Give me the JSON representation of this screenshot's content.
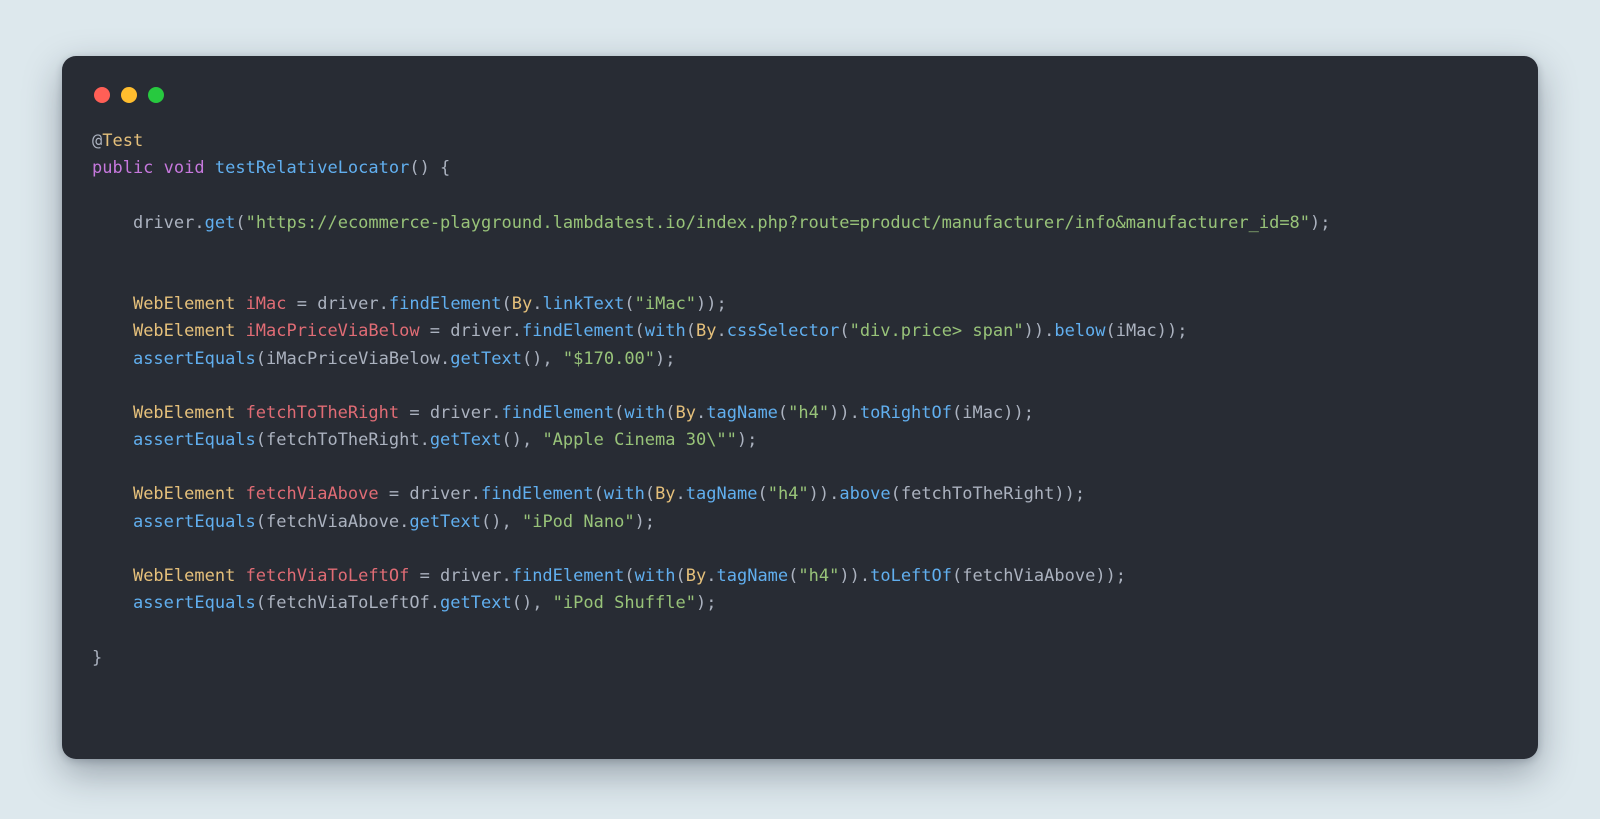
{
  "traffic_lights": {
    "red": "#ff5f56",
    "yellow": "#ffbd2e",
    "green": "#27c93f"
  },
  "code": {
    "annotation": {
      "at": "@",
      "name": "Test"
    },
    "decl": {
      "public": "public",
      "void": "void",
      "fn": "testRelativeLocator",
      "open": "() {"
    },
    "driver_get": {
      "obj": "driver",
      "dot": ".",
      "get": "get",
      "lp": "(",
      "url": "\"https://ecommerce-playground.lambdatest.io/index.php?route=product/manufacturer/info&manufacturer_id=8\"",
      "rp": ");"
    },
    "l1": {
      "type": "WebElement",
      "var": "iMac",
      "eq": " = ",
      "obj": "driver",
      "dot": ".",
      "find": "findElement",
      "lp": "(",
      "by": "By",
      "dot2": ".",
      "linkText": "linkText",
      "lp2": "(",
      "arg": "\"iMac\"",
      "rp2": ")",
      "rp": ");"
    },
    "l2": {
      "type": "WebElement",
      "var": "iMacPriceViaBelow",
      "eq": " = ",
      "obj": "driver",
      "dot": ".",
      "find": "findElement",
      "lp": "(",
      "with": "with",
      "lp2": "(",
      "by": "By",
      "dot2": ".",
      "css": "cssSelector",
      "lp3": "(",
      "sel": "\"div.price> span\"",
      "rp3": ")",
      "rp2": ")",
      "dot3": ".",
      "below": "below",
      "lp4": "(",
      "arg": "iMac",
      "rp4": ")",
      "rp": ");"
    },
    "l3": {
      "assert": "assertEquals",
      "lp": "(",
      "obj": "iMacPriceViaBelow",
      "dot": ".",
      "get": "getText",
      "lp2": "()",
      "comma": ", ",
      "val": "\"$170.00\"",
      "rp": ");"
    },
    "l4": {
      "type": "WebElement",
      "var": "fetchToTheRight",
      "eq": " = ",
      "obj": "driver",
      "dot": ".",
      "find": "findElement",
      "lp": "(",
      "with": "with",
      "lp2": "(",
      "by": "By",
      "dot2": ".",
      "tag": "tagName",
      "lp3": "(",
      "arg": "\"h4\"",
      "rp3": ")",
      "rp2": ")",
      "dot3": ".",
      "toRight": "toRightOf",
      "lp4": "(",
      "argv": "iMac",
      "rp4": ")",
      "rp": ");"
    },
    "l5": {
      "assert": "assertEquals",
      "lp": "(",
      "obj": "fetchToTheRight",
      "dot": ".",
      "get": "getText",
      "lp2": "()",
      "comma": ", ",
      "val": "\"Apple Cinema 30\\\"\"",
      "rp": ");"
    },
    "l6": {
      "type": "WebElement",
      "var": "fetchViaAbove",
      "eq": " = ",
      "obj": "driver",
      "dot": ".",
      "find": "findElement",
      "lp": "(",
      "with": "with",
      "lp2": "(",
      "by": "By",
      "dot2": ".",
      "tag": "tagName",
      "lp3": "(",
      "arg": "\"h4\"",
      "rp3": ")",
      "rp2": ")",
      "dot3": ".",
      "above": "above",
      "lp4": "(",
      "argv": "fetchToTheRight",
      "rp4": ")",
      "rp": ");"
    },
    "l7": {
      "assert": "assertEquals",
      "lp": "(",
      "obj": "fetchViaAbove",
      "dot": ".",
      "get": "getText",
      "lp2": "()",
      "comma": ", ",
      "val": "\"iPod Nano\"",
      "rp": ");"
    },
    "l8": {
      "type": "WebElement",
      "var": "fetchViaToLeftOf",
      "eq": " = ",
      "obj": "driver",
      "dot": ".",
      "find": "findElement",
      "lp": "(",
      "with": "with",
      "lp2": "(",
      "by": "By",
      "dot2": ".",
      "tag": "tagName",
      "lp3": "(",
      "arg": "\"h4\"",
      "rp3": ")",
      "rp2": ")",
      "dot3": ".",
      "toLeft": "toLeftOf",
      "lp4": "(",
      "argv": "fetchViaAbove",
      "rp4": ")",
      "rp": ");"
    },
    "l9": {
      "assert": "assertEquals",
      "lp": "(",
      "obj": "fetchViaToLeftOf",
      "dot": ".",
      "get": "getText",
      "lp2": "()",
      "comma": ", ",
      "val": "\"iPod Shuffle\"",
      "rp": ");"
    },
    "close": "}"
  }
}
